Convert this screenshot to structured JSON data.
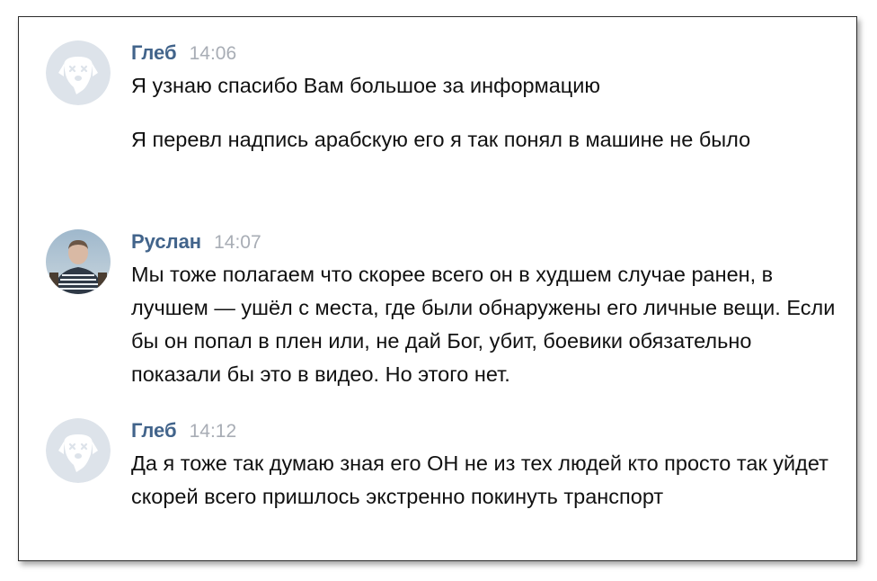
{
  "messages": [
    {
      "author": "Глеб",
      "time": "14:06",
      "avatar": "deactivated-dog-avatar",
      "paragraphs": [
        "Я узнаю спасибо Вам большое за информацию",
        "Я перевл надпись арабскую его я так понял в машине не было"
      ]
    },
    {
      "author": "Руслан",
      "time": "14:07",
      "avatar": "user-photo-avatar",
      "paragraphs": [
        "Мы тоже полагаем что скорее всего он в худшем случае ранен, в лучшем — ушёл с места, где были обнаружены его личные вещи. Если бы он попал в плен или, не дай Бог, убит, боевики обязательно показали бы это в видео. Но этого нет."
      ]
    },
    {
      "author": "Глеб",
      "time": "14:12",
      "avatar": "deactivated-dog-avatar",
      "paragraphs": [
        "Да я тоже так думаю зная его ОН не из тех людей кто просто так уйдет скорей всего пришлось экстренно покинуть транспорт"
      ]
    }
  ],
  "colors": {
    "author": "#42648b",
    "time": "#a8adb5",
    "text": "#111111",
    "avatar_placeholder": "#dde3ea"
  }
}
